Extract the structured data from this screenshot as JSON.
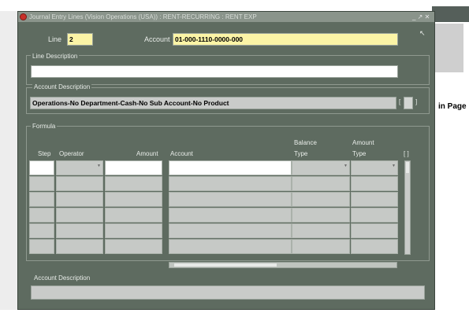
{
  "window": {
    "title": "Journal Entry Lines (Vision Operations (USA)) : RENT-RECURRING : RENT EXP",
    "controls": "_ ↗ ✕"
  },
  "header": {
    "line_label": "Line",
    "line_value": "2",
    "account_label": "Account",
    "account_value": "01-000-1110-0000-000"
  },
  "line_description": {
    "label": "Line Description",
    "value": ""
  },
  "account_description": {
    "label": "Account Description",
    "value": "Operations-No Department-Cash-No Sub Account-No Product",
    "bracket_left": "[",
    "bracket_right": "]"
  },
  "formula": {
    "label": "Formula",
    "columns": {
      "step": "Step",
      "operator": "Operator",
      "amount": "Amount",
      "account": "Account",
      "balance_type_1": "Balance",
      "balance_type_2": "Type",
      "amount_type_1": "Amount",
      "amount_type_2": "Type",
      "folder": "[ ]"
    },
    "rows": [
      {
        "step": "",
        "operator": "",
        "amount": "",
        "account": "",
        "balance_type": "",
        "amount_type": ""
      },
      {
        "step": "",
        "operator": "",
        "amount": "",
        "account": "",
        "balance_type": "",
        "amount_type": ""
      },
      {
        "step": "",
        "operator": "",
        "amount": "",
        "account": "",
        "balance_type": "",
        "amount_type": ""
      },
      {
        "step": "",
        "operator": "",
        "amount": "",
        "account": "",
        "balance_type": "",
        "amount_type": ""
      },
      {
        "step": "",
        "operator": "",
        "amount": "",
        "account": "",
        "balance_type": "",
        "amount_type": ""
      },
      {
        "step": "",
        "operator": "",
        "amount": "",
        "account": "",
        "balance_type": "",
        "amount_type": ""
      }
    ]
  },
  "bottom_account_description": {
    "label": "Account Description",
    "value": ""
  },
  "background": {
    "page_text": "in Page"
  }
}
